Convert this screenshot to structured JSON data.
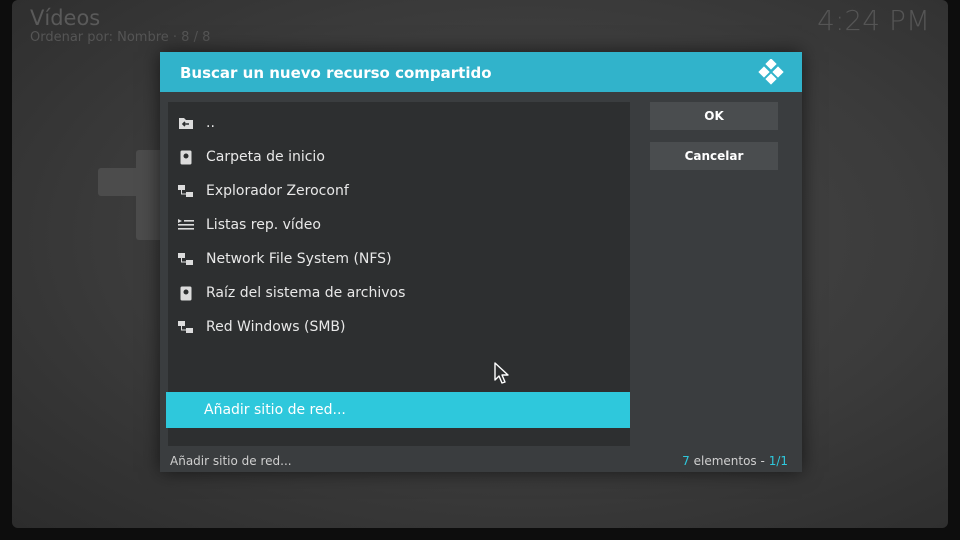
{
  "background": {
    "title": "Vídeos",
    "subtitle": "Ordenar por: Nombre · 8 / 8",
    "clock": "4:24 PM"
  },
  "dialog": {
    "title": "Buscar un nuevo recurso compartido",
    "items": [
      {
        "label": "..",
        "icon": "folder-back-icon"
      },
      {
        "label": "Carpeta de inicio",
        "icon": "drive-icon"
      },
      {
        "label": "Explorador Zeroconf",
        "icon": "network-icon"
      },
      {
        "label": "Listas rep. vídeo",
        "icon": "playlist-icon"
      },
      {
        "label": "Network File System (NFS)",
        "icon": "network-icon"
      },
      {
        "label": "Raíz del sistema de archivos",
        "icon": "drive-icon"
      },
      {
        "label": "Red Windows (SMB)",
        "icon": "network-icon"
      },
      {
        "label": "Añadir sitio de red...",
        "icon": "",
        "selected": true
      }
    ],
    "ok_label": "OK",
    "cancel_label": "Cancelar",
    "footer_selected": "Añadir sitio de red...",
    "footer_count": "7",
    "footer_count_label": "elementos",
    "footer_sep": "-",
    "footer_page": "1/1"
  },
  "colors": {
    "accent": "#31b3cb",
    "selection": "#2ec8dc",
    "dialog_bg": "#3a3d3f",
    "list_bg": "#2d2f30"
  }
}
